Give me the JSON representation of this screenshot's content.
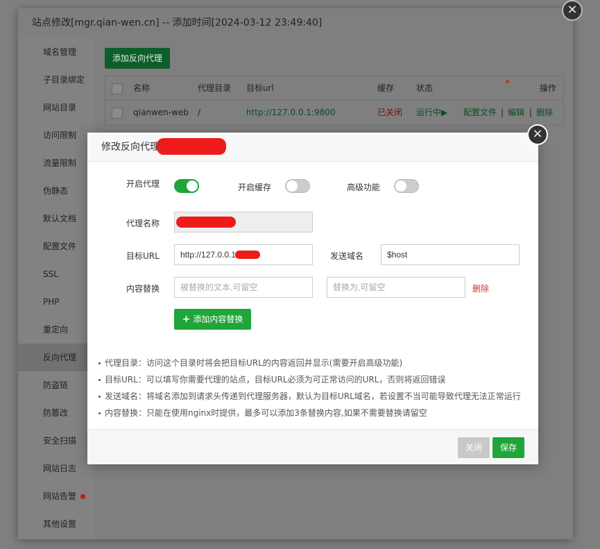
{
  "outer": {
    "title": "站点修改[mgr.qian-wen.cn] -- 添加时间[2024-03-12 23:49:40]",
    "close_glyph": "×"
  },
  "sidebar": {
    "items": [
      {
        "label": "域名管理"
      },
      {
        "label": "子目录绑定"
      },
      {
        "label": "网站目录"
      },
      {
        "label": "访问限制"
      },
      {
        "label": "流量限制"
      },
      {
        "label": "伪静态"
      },
      {
        "label": "默认文档"
      },
      {
        "label": "配置文件"
      },
      {
        "label": "SSL"
      },
      {
        "label": "PHP"
      },
      {
        "label": "重定向"
      },
      {
        "label": "反向代理"
      },
      {
        "label": "防盗链"
      },
      {
        "label": "防篡改"
      },
      {
        "label": "安全扫描"
      },
      {
        "label": "网站日志"
      },
      {
        "label": "网站告警"
      },
      {
        "label": "其他设置"
      }
    ],
    "active_index": 11
  },
  "proxy_list": {
    "add_button": "添加反向代理",
    "headers": [
      "名称",
      "代理目录",
      "目标url",
      "缓存",
      "状态",
      "操作"
    ],
    "row": {
      "name": "qianwen-web",
      "dir": "/",
      "url": "http://127.0.0.1:9800",
      "cache": "已关闭",
      "status": "运行中▶",
      "actions": [
        "配置文件",
        "|",
        "编辑",
        "|",
        "删除"
      ]
    }
  },
  "modal": {
    "title": "修改反向代理",
    "close_glyph": "×",
    "toggles": {
      "proxy_label": "开启代理",
      "proxy_on": true,
      "cache_label": "开启缓存",
      "cache_on": false,
      "advanced_label": "高级功能",
      "advanced_on": false
    },
    "fields": {
      "name_label": "代理名称",
      "target_label": "目标URL",
      "target_value": "http://127.0.0.1",
      "host_label": "发送域名",
      "host_value": "$host",
      "replace_label": "内容替换",
      "replace_from_placeholder": "被替换的文本,可留空",
      "replace_to_placeholder": "替换为,可留空",
      "delete_label": "删除"
    },
    "add_content_button": "添加内容替换",
    "notes": [
      "代理目录：访问这个目录时将会把目标URL的内容返回并显示(需要开启高级功能)",
      "目标URL：可以填写你需要代理的站点，目标URL必须为可正常访问的URL，否则将返回错误",
      "发送域名：将域名添加到请求头传递到代理服务器，默认为目标URL域名，若设置不当可能导致代理无法正常运行",
      "内容替换：只能在使用nginx时提供，最多可以添加3条替换内容,如果不需要替换请留空"
    ],
    "footer": {
      "close_label": "关闭",
      "save_label": "保存"
    }
  },
  "colors": {
    "accent_green": "#20a53a",
    "danger_red": "#d9302c",
    "redaction": "#ee1b1b"
  }
}
